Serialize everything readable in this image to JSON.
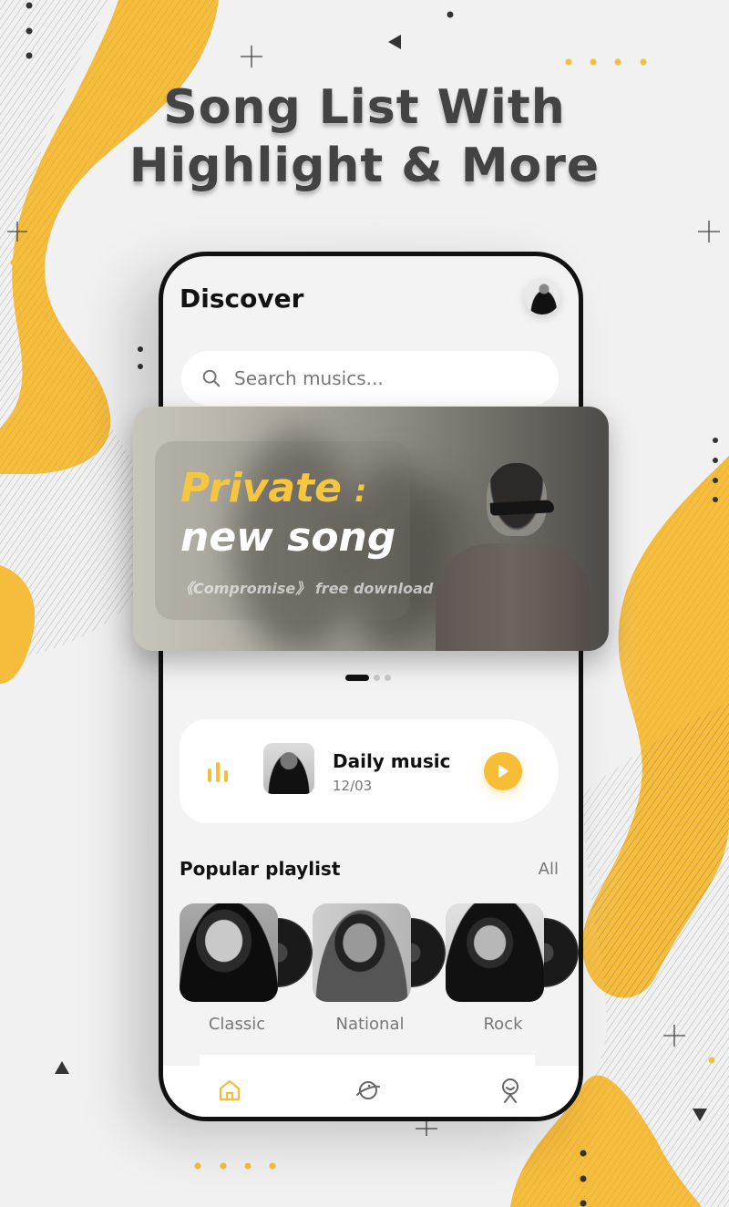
{
  "headline": {
    "line1": "Song List With",
    "line2": "Highlight & More"
  },
  "colors": {
    "accent": "#f8bd36",
    "text_dark": "#121212",
    "text_muted": "#777777",
    "background": "#f1f1f1"
  },
  "app": {
    "title": "Discover",
    "avatar_icon": "user-avatar",
    "search": {
      "placeholder": "Search musics...",
      "value": "",
      "icon": "search-icon"
    },
    "banner": {
      "title_line1": "Private",
      "title_colon": ":",
      "title_line2": "new song",
      "subtitle": "《Compromise》 free download",
      "page_count": 3,
      "active_page": 1
    },
    "daily": {
      "icon": "equalizer-icon",
      "title": "Daily music",
      "date": "12/03",
      "play_icon": "play-icon"
    },
    "popular": {
      "title": "Popular playlist",
      "all_label": "All",
      "items": [
        {
          "name": "Classic"
        },
        {
          "name": "National"
        },
        {
          "name": "Rock"
        }
      ]
    },
    "tabs": [
      {
        "name": "home",
        "icon": "home-icon",
        "active": true
      },
      {
        "name": "explore",
        "icon": "planet-icon",
        "active": false
      },
      {
        "name": "profile",
        "icon": "profile-icon",
        "active": false
      }
    ]
  }
}
